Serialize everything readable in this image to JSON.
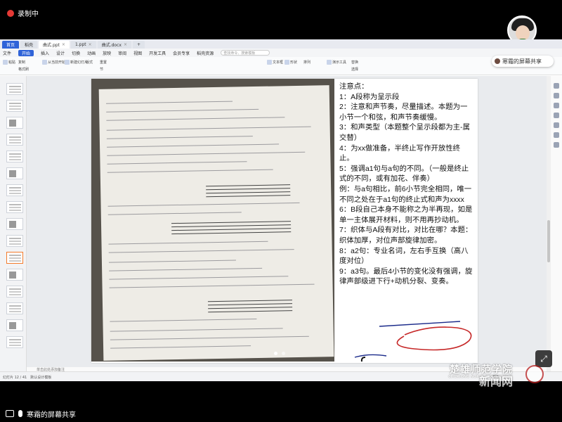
{
  "recording": {
    "label": "录制中"
  },
  "share": {
    "presenter_label": "寒霜的屏幕共享"
  },
  "tabs": [
    {
      "label": "首页"
    },
    {
      "label": "稻壳"
    },
    {
      "label": "曲式.ppt"
    },
    {
      "label": "1.ppt"
    },
    {
      "label": "曲式.docx"
    }
  ],
  "menu": {
    "file": "文件",
    "items": [
      "开始",
      "插入",
      "设计",
      "切换",
      "动画",
      "放映",
      "审阅",
      "视图",
      "开发工具",
      "会员专享",
      "稻壳资源"
    ],
    "search_placeholder": "查找命令、搜索模板"
  },
  "ribbon": {
    "items": [
      "粘贴",
      "复制",
      "格式刷",
      "从当前开始",
      "新建幻灯片",
      "版式",
      "重置",
      "节",
      "文本框",
      "形状",
      "排列",
      "演示工具",
      "替换",
      "选择"
    ]
  },
  "slide_notes": {
    "lines": [
      "注意点：",
      "1：A段称为呈示段",
      "2：注意和声节奏，尽量描述。本题为一小节一个和弦，和声节奏缓慢。",
      "3：和声类型（本题整个呈示段都为主-属交替）",
      "4：为xx做准备，半终止写作开放性终止。",
      "5：强调a1句与a句的不同。（一般是终止式的不同，或有加花、伴奏）",
      "例：与a句相比，前6小节完全相同，唯一不同之处在于a1句的终止式和声为xxxx",
      "6：B段自己本身不能称之为半再现，如是单一主体展开材料，则不用再抄动机。",
      "7：织体与A段有对比，对比在哪？本题：织体加厚，对位声部旋律加密。",
      "8：a2句：专业名词，左右手互换（高八度对位）",
      "9：a3句。最后4小节的变化没有强调，旋律声部级进下行+动机分裂、变奏。"
    ]
  },
  "thumbs": {
    "count": 16,
    "selected": 10
  },
  "comment_bar": {
    "label": "单击此处添加备注"
  },
  "status": {
    "slide_info": "幻灯片 12 / 41",
    "theme": "默认设计模板",
    "zoom": "75%"
  },
  "watermark": {
    "cn": "楚雄师范学院",
    "en": "CHUXIONG NORMAL UNIVERSITY",
    "news": "新闻网"
  },
  "colors": {
    "accent": "#2f63d8",
    "recording": "#e53935",
    "annotation": "#1a2a8a",
    "circle": "#c62828"
  }
}
